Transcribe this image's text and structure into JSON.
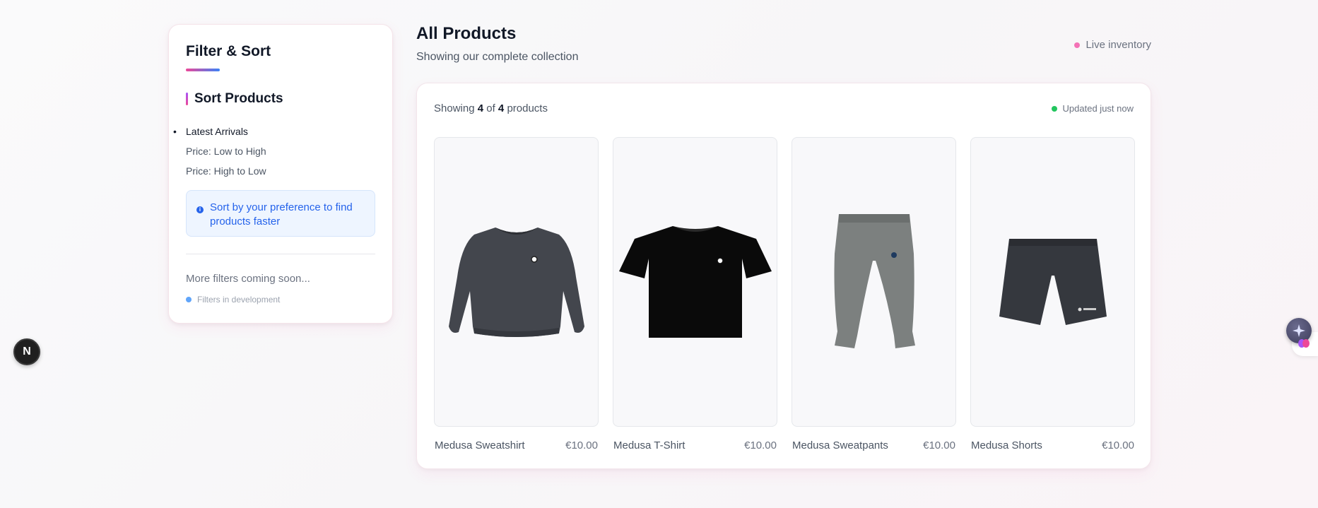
{
  "sidebar": {
    "title": "Filter & Sort",
    "section_label": "Sort Products",
    "sort_options": [
      {
        "label": "Latest Arrivals",
        "active": true
      },
      {
        "label": "Price: Low to High",
        "active": false
      },
      {
        "label": "Price: High to Low",
        "active": false
      }
    ],
    "info_text": "Sort by your preference to find products faster",
    "more_filters": "More filters coming soon...",
    "dev_status": "Filters in development"
  },
  "header": {
    "title": "All Products",
    "subtitle": "Showing our complete collection",
    "live_label": "Live inventory"
  },
  "panel": {
    "count_prefix": "Showing",
    "count_shown": "4",
    "count_of": "of",
    "count_total": "4",
    "count_suffix": "products",
    "updated_label": "Updated just now"
  },
  "products": [
    {
      "name": "Medusa Sweatshirt",
      "price": "€10.00"
    },
    {
      "name": "Medusa T-Shirt",
      "price": "€10.00"
    },
    {
      "name": "Medusa Sweatpants",
      "price": "€10.00"
    },
    {
      "name": "Medusa Shorts",
      "price": "€10.00"
    }
  ],
  "floating": {
    "next_badge": "N"
  },
  "colors": {
    "accent_pink": "#ec4899",
    "accent_blue": "#3b82f6",
    "live_dot": "#f472b6",
    "updated_dot": "#22c55e",
    "info_blue": "#2563eb"
  }
}
